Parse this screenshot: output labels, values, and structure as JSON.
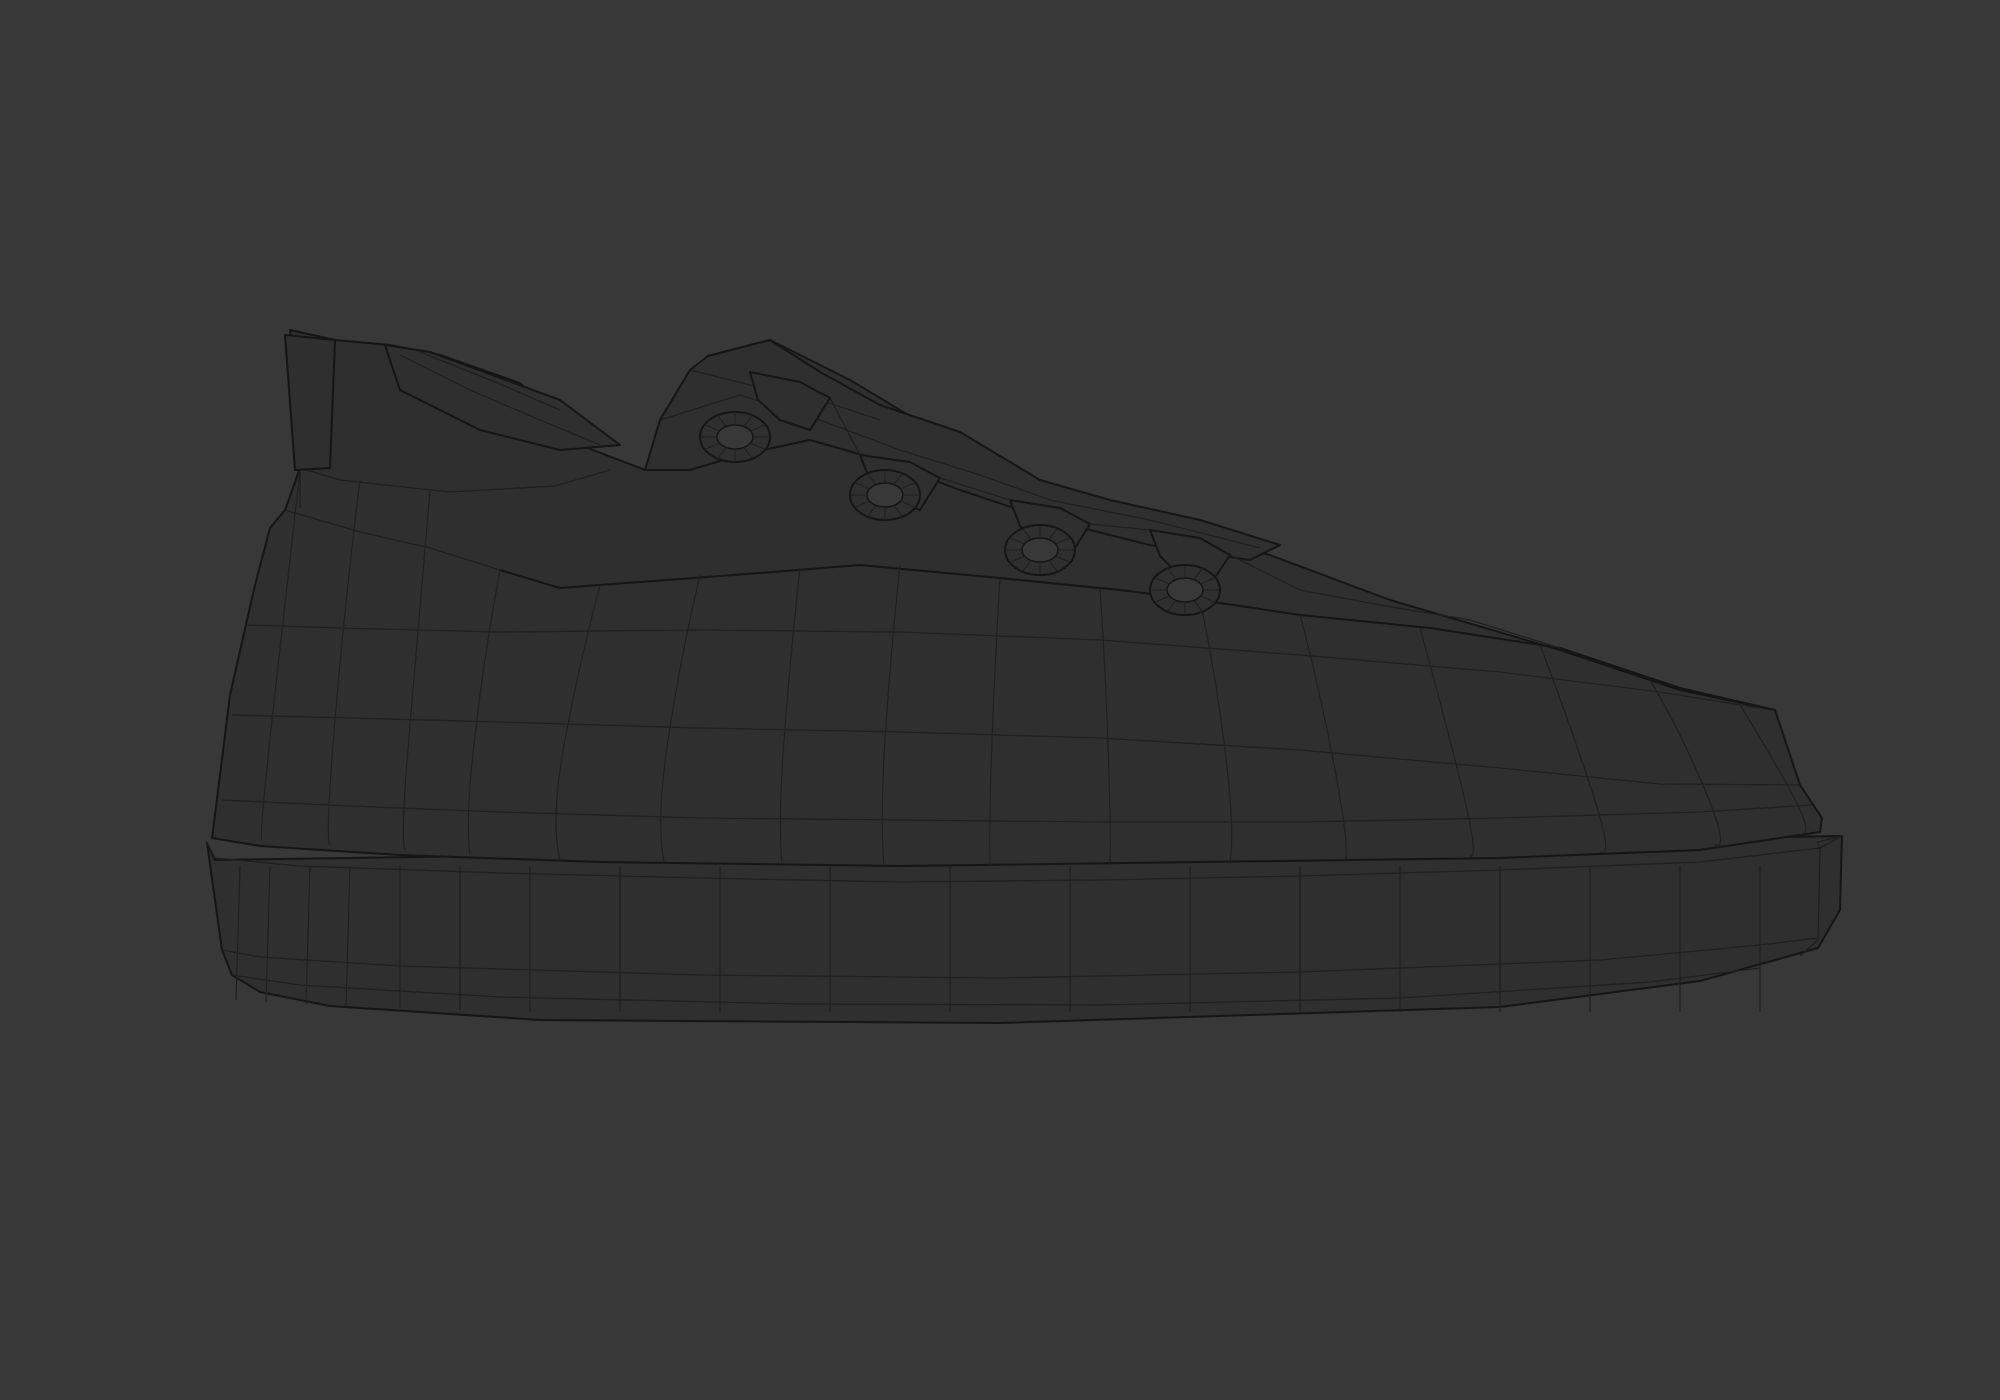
{
  "viewport": {
    "background_color": "#383838",
    "mesh_fill_color": "#2f2f2f",
    "wire_color": "#1f1f1f",
    "outline_color": "#151515",
    "shading": "wireframe",
    "view": "side",
    "object": "sneaker-model",
    "eyelet_count": 4
  }
}
